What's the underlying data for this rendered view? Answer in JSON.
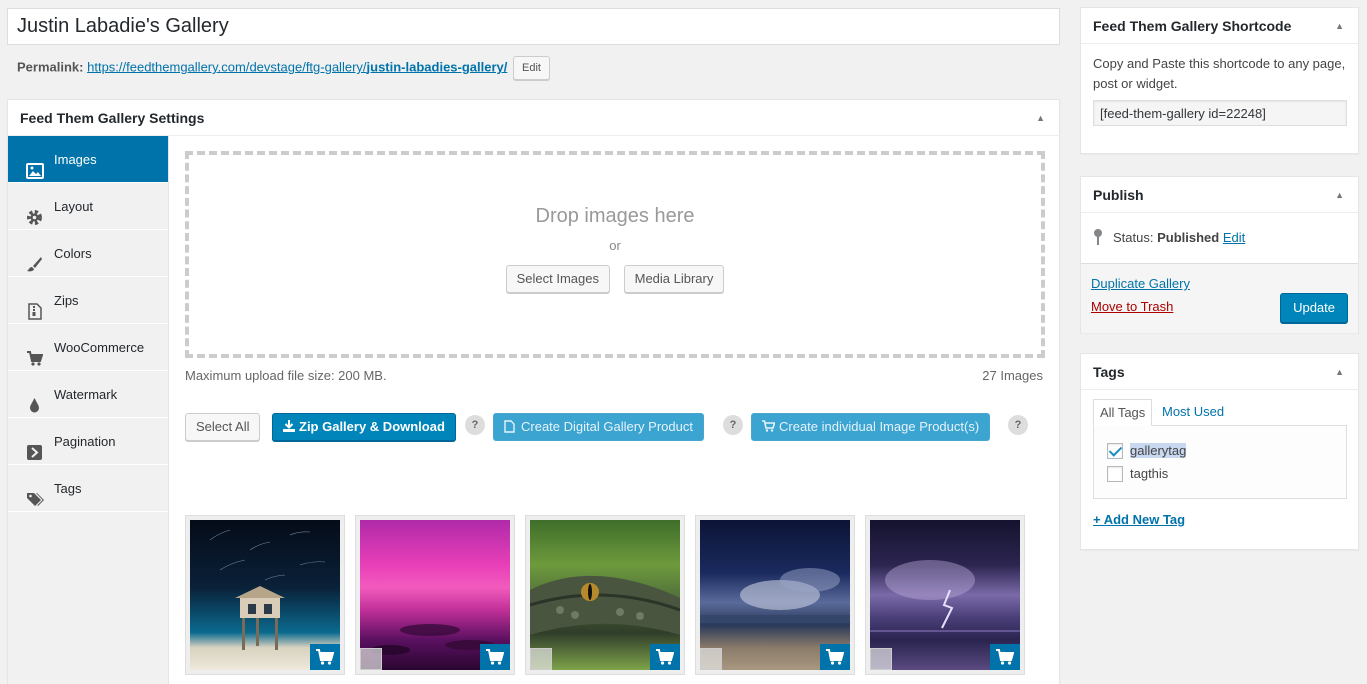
{
  "post": {
    "title": "Justin Labadie's Gallery",
    "permalink_label": "Permalink:",
    "permalink_base": "https://feedthemgallery.com/devstage/ftg-gallery/",
    "permalink_slug": "justin-labadies-gallery/",
    "permalink_edit": "Edit"
  },
  "settings": {
    "title": "Feed Them Gallery Settings",
    "tabs": [
      {
        "label": "Images",
        "icon": "image-icon",
        "active": true
      },
      {
        "label": "Layout",
        "icon": "gear-icon"
      },
      {
        "label": "Colors",
        "icon": "paintbrush-icon"
      },
      {
        "label": "Zips",
        "icon": "zip-file-icon"
      },
      {
        "label": "WooCommerce",
        "icon": "cart-icon"
      },
      {
        "label": "Watermark",
        "icon": "droplet-icon"
      },
      {
        "label": "Pagination",
        "icon": "arrow-right-icon"
      },
      {
        "label": "Tags",
        "icon": "tags-icon"
      }
    ],
    "dropzone": {
      "title": "Drop images here",
      "or": "or",
      "select_images": "Select Images",
      "media_library": "Media Library"
    },
    "upload_info": "Maximum upload file size: 200 MB.",
    "image_count": "27 Images",
    "actions": {
      "select_all": "Select All",
      "zip_download": "Zip Gallery & Download",
      "create_digital": "Create Digital Gallery Product",
      "create_individual": "Create individual Image Product(s)",
      "help": "?"
    },
    "thumbnails": [
      {
        "name": "lifeguard-tower-star-trails"
      },
      {
        "name": "magenta-sunset-sea"
      },
      {
        "name": "alligator-closeup"
      },
      {
        "name": "night-beach-clouds"
      },
      {
        "name": "lightning-storm-sea"
      }
    ]
  },
  "shortcode": {
    "title": "Feed Them Gallery Shortcode",
    "description": "Copy and Paste this shortcode to any page, post or widget.",
    "value": "[feed-them-gallery id=22248]"
  },
  "publish": {
    "title": "Publish",
    "status_label": "Status:",
    "status_value": "Published",
    "status_edit": "Edit",
    "duplicate": "Duplicate Gallery",
    "trash": "Move to Trash",
    "update": "Update"
  },
  "tags": {
    "title": "Tags",
    "tab_all": "All Tags",
    "tab_most_used": "Most Used",
    "items": [
      {
        "label": "gallerytag",
        "checked": true
      },
      {
        "label": "tagthis",
        "checked": false
      }
    ],
    "add_new": "+ Add New Tag"
  },
  "colors": {
    "primary": "#0085ba",
    "active_tab": "#0073aa",
    "link": "#0073aa",
    "trash": "#aa0000"
  }
}
